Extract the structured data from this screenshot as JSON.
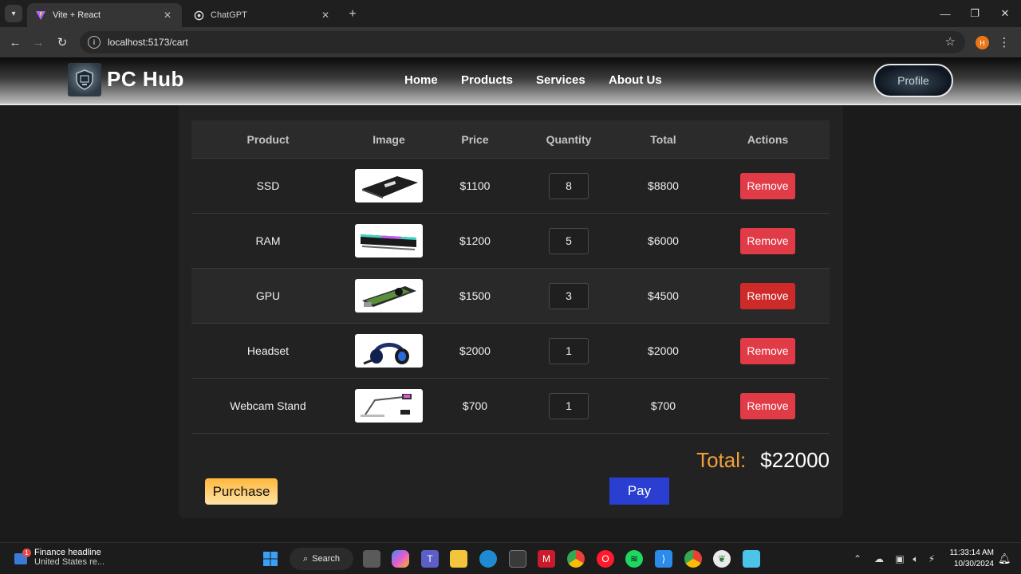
{
  "browser": {
    "tabs": [
      {
        "title": "Vite + React",
        "icon": "vite-icon",
        "active": true
      },
      {
        "title": "ChatGPT",
        "icon": "chatgpt-icon",
        "active": false
      }
    ],
    "url": "localhost:5173/cart",
    "profile_initial": "H"
  },
  "site": {
    "brand": "PC Hub",
    "nav": [
      "Home",
      "Products",
      "Services",
      "About Us"
    ],
    "profile_label": "Profile"
  },
  "cart": {
    "columns": [
      "Product",
      "Image",
      "Price",
      "Quantity",
      "Total",
      "Actions"
    ],
    "rows": [
      {
        "product": "SSD",
        "image": "ssd-image",
        "price": "$1100",
        "quantity": "8",
        "total": "$8800",
        "action": "Remove"
      },
      {
        "product": "RAM",
        "image": "ram-image",
        "price": "$1200",
        "quantity": "5",
        "total": "$6000",
        "action": "Remove"
      },
      {
        "product": "GPU",
        "image": "gpu-image",
        "price": "$1500",
        "quantity": "3",
        "total": "$4500",
        "action": "Remove"
      },
      {
        "product": "Headset",
        "image": "headset-image",
        "price": "$2000",
        "quantity": "1",
        "total": "$2000",
        "action": "Remove"
      },
      {
        "product": "Webcam Stand",
        "image": "webcam-stand-image",
        "price": "$700",
        "quantity": "1",
        "total": "$700",
        "action": "Remove"
      }
    ],
    "total_label": "Total:",
    "total_amount": "$22000",
    "purchase_label": "Purchase",
    "pay_label": "Pay"
  },
  "taskbar": {
    "news_badge": "1",
    "news_title": "Finance headline",
    "news_subtitle": "United States re...",
    "search_label": "Search",
    "time": "11:33:14 AM",
    "date": "10/30/2024"
  },
  "colors": {
    "accent_total": "#f0a03a",
    "remove_button": "#e23b48",
    "pay_button": "#2a3fd1",
    "purchase_button": "#ffb83c"
  }
}
